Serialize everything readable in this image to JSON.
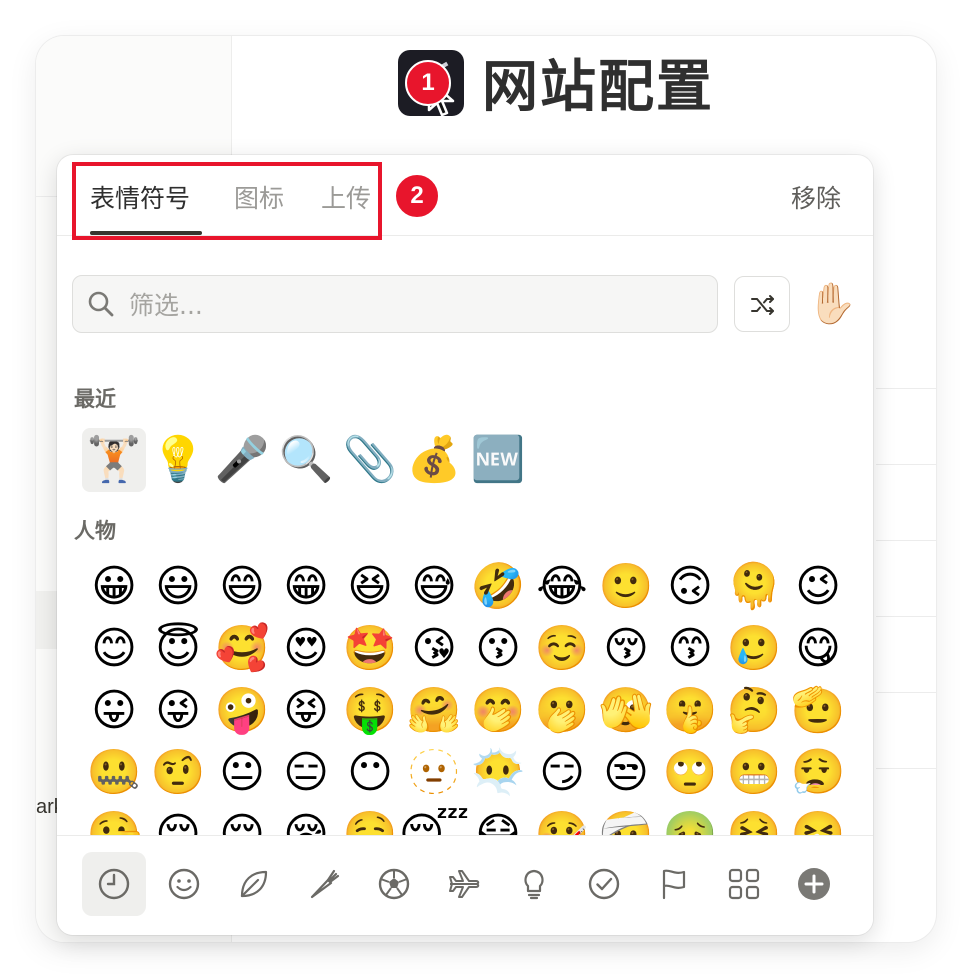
{
  "page": {
    "title": "网站配置",
    "icon": "astronaut-page-icon"
  },
  "callouts": [
    "1",
    "2"
  ],
  "picker": {
    "tabs": [
      "表情符号",
      "图标",
      "上传"
    ],
    "active_tab": "表情符号",
    "remove_label": "移除",
    "search_placeholder": "筛选...",
    "skin_tone": "✋🏻",
    "sections": {
      "recent_label": "最近",
      "people_label": "人物"
    },
    "recent": [
      "🏋🏻",
      "💡",
      "🎤",
      "🔍",
      "📎",
      "💰",
      "🆕"
    ],
    "people_rows": [
      [
        "😀",
        "😃",
        "😄",
        "😁",
        "😆",
        "😅",
        "🤣",
        "😂",
        "🙂",
        "🙃",
        "🫠",
        "😉"
      ],
      [
        "😊",
        "😇",
        "🥰",
        "😍",
        "🤩",
        "😘",
        "😗",
        "☺️",
        "😚",
        "😙",
        "🥲",
        "😋"
      ],
      [
        "😛",
        "😜",
        "🤪",
        "😝",
        "🤑",
        "🤗",
        "🤭",
        "🫢",
        "🫣",
        "🤫",
        "🤔",
        "🫡"
      ],
      [
        "🤐",
        "🤨",
        "😐",
        "😑",
        "😶",
        "🫥",
        "😶‍🌫️",
        "😏",
        "😒",
        "🙄",
        "😬",
        "😮‍💨"
      ],
      [
        "🤥",
        "😌",
        "😔",
        "😪",
        "🤤",
        "😴",
        "😷",
        "🤒",
        "🤕",
        "🤢",
        "🤮",
        "🤧"
      ]
    ],
    "categories": [
      "recent-clock-icon",
      "smiley-icon",
      "leaf-icon",
      "carrot-icon",
      "soccer-ball-icon",
      "airplane-icon",
      "lightbulb-icon",
      "checkmark-circle-icon",
      "flag-icon",
      "grid-icon",
      "plus-circle-icon"
    ],
    "active_category": "recent-clock-icon"
  },
  "sidebar_partial_text": "ark",
  "colors": {
    "accent_red": "#e8152c",
    "text_primary": "#2f2f2f",
    "text_muted": "#9b9a97"
  }
}
